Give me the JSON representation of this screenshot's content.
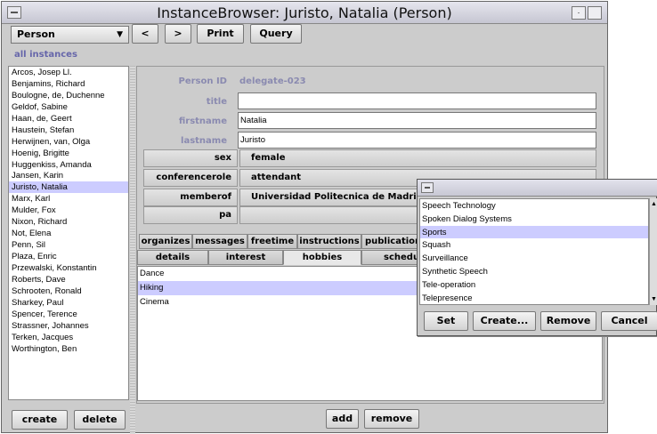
{
  "window": {
    "title": "InstanceBrowser: Juristo, Natalia (Person)",
    "sysmenu_icon": "sysmenu-icon",
    "minimize_glyph": "·",
    "maximize_glyph": ""
  },
  "toolbar": {
    "class_selector": "Person",
    "class_selector_arrow": "▼",
    "prev_label": "<",
    "next_label": ">",
    "print_label": "Print",
    "query_label": "Query"
  },
  "filter_label": "all instances",
  "instances": [
    "Arcos, Josep Ll.",
    "Benjamins, Richard",
    "Boulogne, de, Duchenne",
    "Geldof, Sabine",
    "Haan, de, Geert",
    "Haustein, Stefan",
    "Herwijnen, van, Olga",
    "Hoenig, Brigitte",
    "Huggenkiss, Amanda",
    "Jansen, Karin",
    "Juristo, Natalia",
    "Marx, Karl",
    "Mulder, Fox",
    "Nixon, Richard",
    "Not, Elena",
    "Penn, Sil",
    "Plaza, Enric",
    "Przewalski, Konstantin",
    "Roberts, Dave",
    "Schrooten, Ronald",
    "Sharkey, Paul",
    "Spencer, Terence",
    "Strassner, Johannes",
    "Terken, Jacques",
    "Worthington, Ben"
  ],
  "selected_instance": "Juristo, Natalia",
  "instance_buttons": {
    "create": "create",
    "delete": "delete"
  },
  "form": {
    "person_id_label": "Person ID",
    "person_id_value": "delegate-023",
    "title_label": "title",
    "title_value": "",
    "firstname_label": "firstname",
    "firstname_value": "Natalia",
    "lastname_label": "lastname",
    "lastname_value": "Juristo",
    "sex_label": "sex",
    "sex_value": "female",
    "conferencerole_label": "conferencerole",
    "conferencerole_value": "attendant",
    "memberof_label": "memberof",
    "memberof_value": "Universidad Politecnica de Madrid",
    "pa_label": "pa",
    "pa_value": ""
  },
  "tabs_row1": [
    "organizes",
    "messages",
    "freetime",
    "instructions",
    "publications"
  ],
  "tabs_row2": [
    "details",
    "interest",
    "hobbies",
    "schedule"
  ],
  "active_tab": "hobbies",
  "hobbies": [
    "Dance",
    "Hiking",
    "Cinema"
  ],
  "selected_hobby": "Hiking",
  "hobby_buttons": {
    "add": "add",
    "remove": "remove"
  },
  "popup": {
    "items": [
      "Speech Technology",
      "Spoken Dialog Systems",
      "Sports",
      "Squash",
      "Surveillance",
      "Synthetic Speech",
      "Tele-operation",
      "Telepresence"
    ],
    "selected": "Sports",
    "set_label": "Set",
    "create_label": "Create...",
    "remove_label": "Remove",
    "cancel_label": "Cancel"
  },
  "colors": {
    "selection": "#ccccff",
    "label_text": "#8a8ab0",
    "panel_bg": "#cccccc"
  }
}
